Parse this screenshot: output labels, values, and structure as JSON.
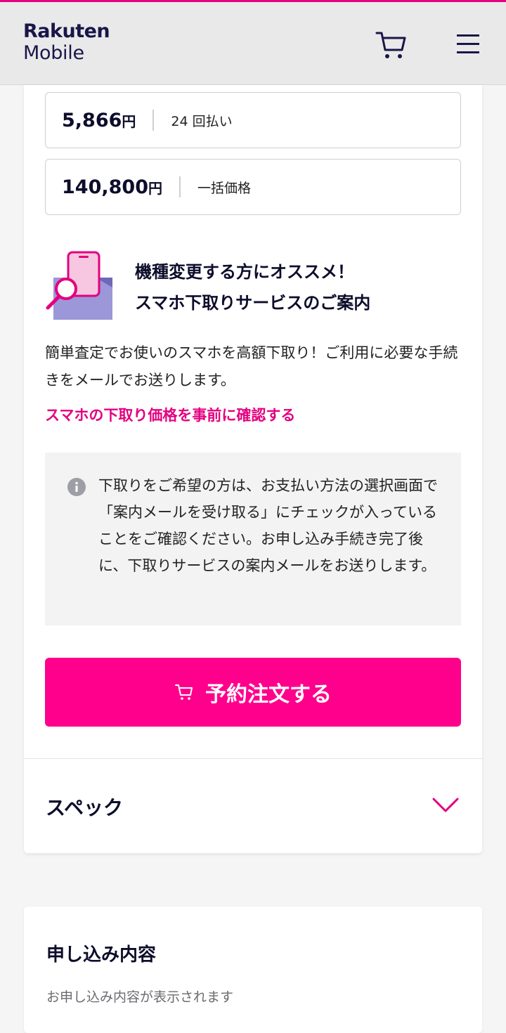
{
  "header": {
    "logo_line1": "Rakuten",
    "logo_line2": "Mobile",
    "cart_icon": "cart-icon",
    "menu_icon": "hamburger-menu-icon"
  },
  "prices": [
    {
      "amount": "5,866",
      "unit": "円",
      "label": "24 回払い"
    },
    {
      "amount": "140,800",
      "unit": "円",
      "label": "一括価格"
    }
  ],
  "promo": {
    "title_line1": "機種変更する方にオススメ！",
    "title_line2": "スマホ下取りサービスのご案内",
    "description": "簡単査定でお使いのスマホを高額下取り！ご利用に必要な手続きをメールでお送りします。",
    "link": "スマホの下取り価格を事前に確認する"
  },
  "notice": {
    "icon": "info-icon",
    "text": "下取りをご希望の方は、お支払い方法の選択画面で「案内メールを受け取る」にチェックが入っていることをご確認ください。お申し込み手続き完了後に、下取りサービスの案内メールをお送りします。"
  },
  "order_button": {
    "label": "予約注文する",
    "icon": "cart-icon"
  },
  "spec": {
    "label": "スペック",
    "icon": "chevron-down-icon"
  },
  "application": {
    "title": "申し込み内容",
    "subtitle": "お申し込み内容が表示されます"
  },
  "colors": {
    "brand_pink": "#e4007f",
    "button_pink": "#ff008c",
    "navy": "#0d0d2b",
    "header_bg": "#e9e9ea"
  }
}
